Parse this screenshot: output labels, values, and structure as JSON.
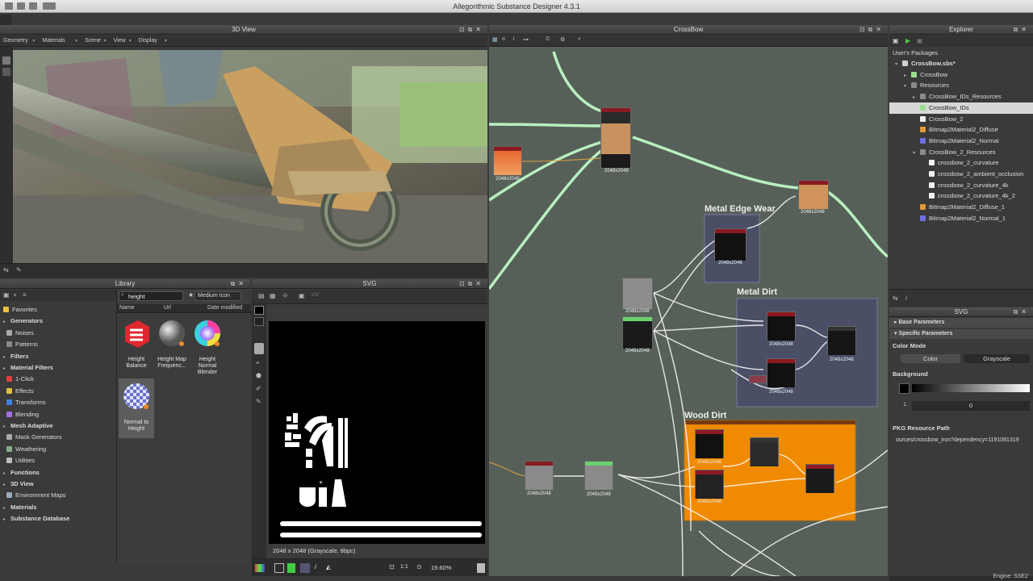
{
  "window": {
    "title": "Allegorithmic Substance Designer 4.3.1"
  },
  "viewport3d": {
    "title": "3D View",
    "menu": [
      "Geometry",
      "Materials",
      "Scene",
      "View",
      "Display"
    ]
  },
  "library": {
    "title": "Library",
    "search_value": "height",
    "view_mode": "Medium Icon",
    "columns": [
      "Name",
      "Url",
      "Date modified"
    ],
    "categories": [
      {
        "label": "Favorites",
        "header": false,
        "indent": 0,
        "icon": "star-icon"
      },
      {
        "label": "Generators",
        "header": true,
        "indent": 0,
        "icon": "arrow-icon"
      },
      {
        "label": "Noises",
        "header": false,
        "indent": 1,
        "icon": "noise-icon"
      },
      {
        "label": "Patterns",
        "header": false,
        "indent": 1,
        "icon": "pattern-icon"
      },
      {
        "label": "Filters",
        "header": true,
        "indent": 0,
        "icon": "arrow-icon"
      },
      {
        "label": "Material Filters",
        "header": true,
        "indent": 0,
        "icon": "arrow-icon"
      },
      {
        "label": "1-Click",
        "header": false,
        "indent": 1,
        "icon": "click-icon"
      },
      {
        "label": "Effects",
        "header": false,
        "indent": 1,
        "icon": "effects-icon"
      },
      {
        "label": "Transforms",
        "header": false,
        "indent": 1,
        "icon": "transforms-icon"
      },
      {
        "label": "Blending",
        "header": false,
        "indent": 1,
        "icon": "blending-icon"
      },
      {
        "label": "Mesh Adaptive",
        "header": true,
        "indent": 0,
        "icon": "arrow-icon"
      },
      {
        "label": "Mask Generators",
        "header": false,
        "indent": 1,
        "icon": "mask-icon"
      },
      {
        "label": "Weathering",
        "header": false,
        "indent": 1,
        "icon": "weathering-icon"
      },
      {
        "label": "Utilities",
        "header": false,
        "indent": 1,
        "icon": "utilities-icon"
      },
      {
        "label": "Functions",
        "header": true,
        "indent": 0,
        "icon": "arrow-icon"
      },
      {
        "label": "3D View",
        "header": true,
        "indent": 0,
        "icon": "arrow-icon"
      },
      {
        "label": "Environment Maps",
        "header": false,
        "indent": 1,
        "icon": "envmap-icon"
      },
      {
        "label": "Materials",
        "header": true,
        "indent": 0,
        "icon": "arrow-icon"
      },
      {
        "label": "Substance Database",
        "header": true,
        "indent": 0,
        "icon": "arrow-icon"
      }
    ],
    "items": [
      {
        "label": "Height Balance"
      },
      {
        "label": "Height Map Frequenc..."
      },
      {
        "label": "Height Normal Blender"
      },
      {
        "label": "Normal to Height"
      }
    ]
  },
  "svg_view": {
    "title": "SVG",
    "info": "2048 x 2048 (Grayscale, 8bpc)",
    "ratio": "1:1",
    "zoom": "19.60%"
  },
  "graph": {
    "title": "CrossBow",
    "frames": [
      "Metal Edge Wear",
      "Metal Dirt",
      "Wood Dirt"
    ],
    "res": "2048x2048"
  },
  "explorer": {
    "title": "Explorer",
    "root_label": "User's Packages",
    "tree": [
      {
        "label": "CrossBow.sbs*",
        "indent": 1,
        "arrow": "▾",
        "color": "#d0d0d0",
        "bold": true
      },
      {
        "label": "CrossBow",
        "indent": 2,
        "arrow": "▸",
        "color": "#9bdc8c",
        "bold": false
      },
      {
        "label": "Resources",
        "indent": 2,
        "arrow": "▾",
        "color": "#8a8a8a",
        "bold": false
      },
      {
        "label": "CrossBow_IDs_Resources",
        "indent": 3,
        "arrow": "▸",
        "color": "#8a8a8a",
        "bold": false
      },
      {
        "label": "CrossBow_IDs",
        "indent": 3,
        "arrow": "",
        "color": "#9bdc8c",
        "bold": false,
        "selected": true
      },
      {
        "label": "CrossBow_2",
        "indent": 3,
        "arrow": "",
        "color": "#f0f0f0",
        "bold": false
      },
      {
        "label": "Bitmap2Material2_Diffuse",
        "indent": 3,
        "arrow": "",
        "color": "#e09a3a",
        "bold": false
      },
      {
        "label": "Bitmap2Material2_Normal",
        "indent": 3,
        "arrow": "",
        "color": "#7070e0",
        "bold": false
      },
      {
        "label": "CrossBow_2_Resources",
        "indent": 3,
        "arrow": "▾",
        "color": "#8a8a8a",
        "bold": false
      },
      {
        "label": "crossbow_2_curvature",
        "indent": 4,
        "arrow": "",
        "color": "#f0f0f0",
        "bold": false
      },
      {
        "label": "crossbow_2_ambient_occlusion",
        "indent": 4,
        "arrow": "",
        "color": "#f0f0f0",
        "bold": false
      },
      {
        "label": "crossbow_2_curvature_4k",
        "indent": 4,
        "arrow": "",
        "color": "#f0f0f0",
        "bold": false
      },
      {
        "label": "crossbow_2_curvature_4k_2",
        "indent": 4,
        "arrow": "",
        "color": "#f0f0f0",
        "bold": false
      },
      {
        "label": "Bitmap2Material2_Diffuse_1",
        "indent": 3,
        "arrow": "",
        "color": "#e09a3a",
        "bold": false
      },
      {
        "label": "Bitmap2Material2_Normal_1",
        "indent": 3,
        "arrow": "",
        "color": "#7070e0",
        "bold": false
      }
    ]
  },
  "params": {
    "title": "SVG",
    "base_section": "Base Parameters",
    "specific_section": "Specific Parameters",
    "color_mode_label": "Color Mode",
    "color_option": "Color",
    "grayscale_option": "Grayscale",
    "background_label": "Background",
    "l_label": "L",
    "l_value": "0",
    "pkg_label": "PKG Resource Path",
    "pkg_value": "ources/crossbow_iron?dependency=1191081319"
  },
  "statusbar": {
    "engine": "Engine: SSE2"
  },
  "colors": {
    "panel": "#3a3a3a",
    "graph_bg": "#566058",
    "wire": "#b8f0c0",
    "frame_wood": "#f08a00",
    "frame_metal": "#4a4f66"
  }
}
